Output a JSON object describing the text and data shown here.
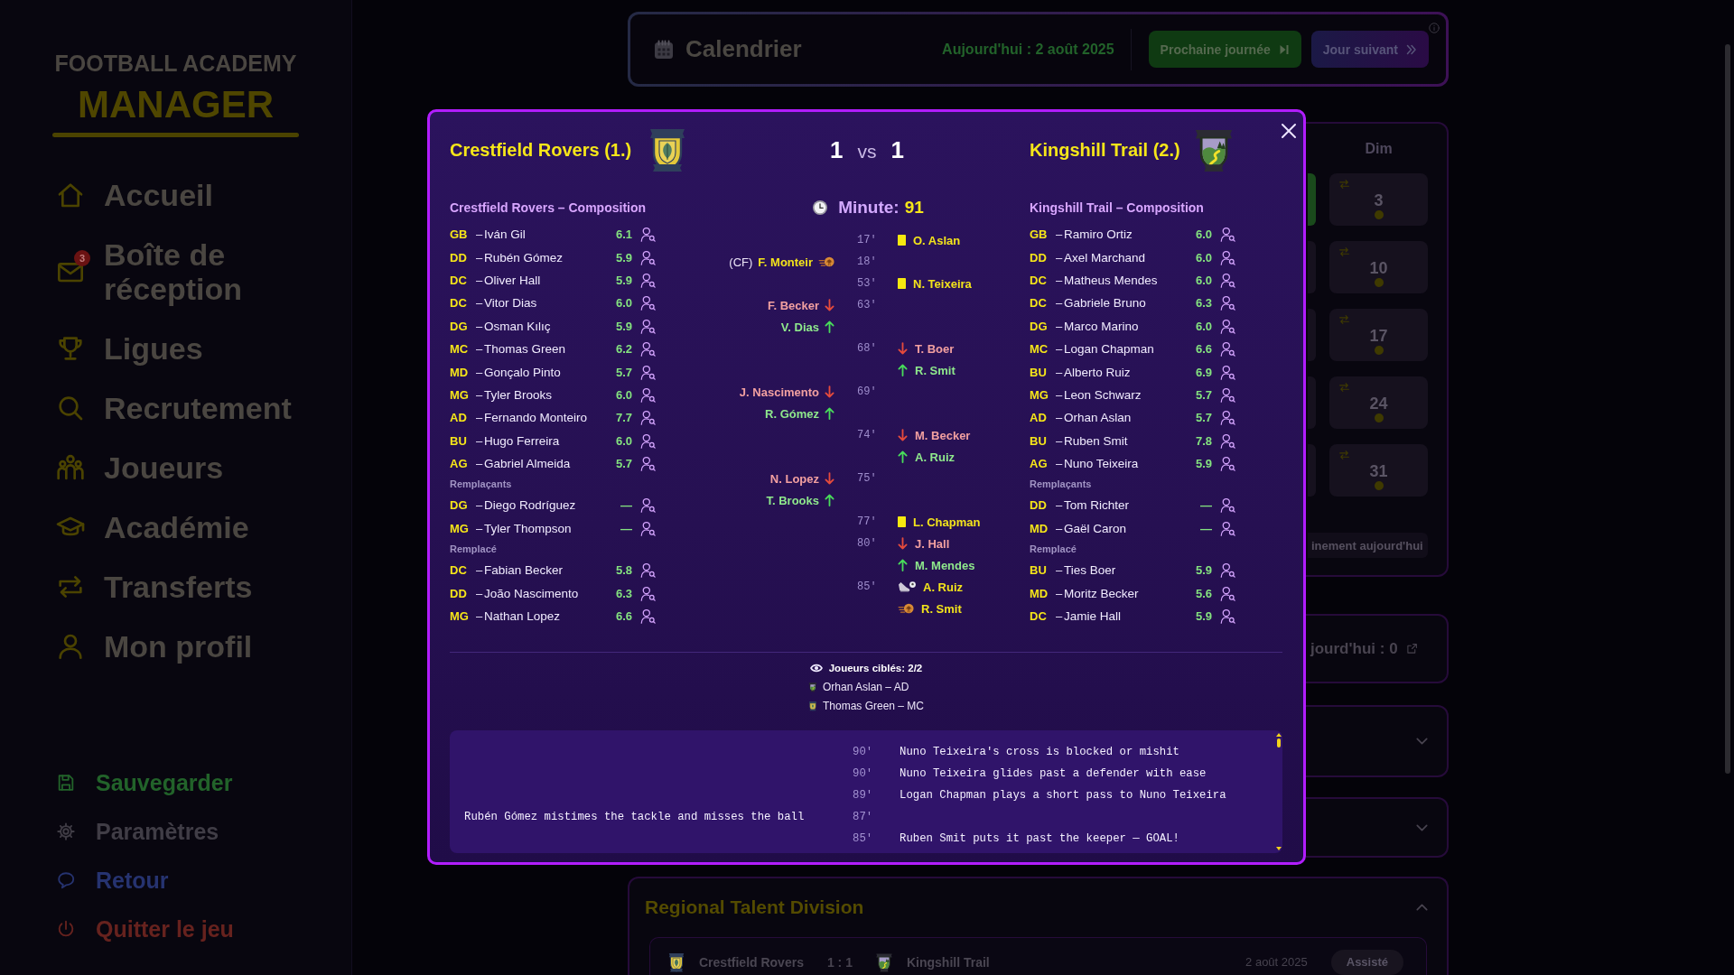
{
  "sidebar": {
    "logo": {
      "line_1": "FOOTBALL ACADEMY",
      "line_2": "MANAGER"
    },
    "nav_items": [
      {
        "label": "Accueil",
        "selected": false
      },
      {
        "label": "Boîte de réception",
        "selected": false,
        "badge": "3"
      },
      {
        "label": "Ligues",
        "selected": false
      },
      {
        "label": "Recrutement",
        "selected": false
      },
      {
        "label": "Joueurs",
        "selected": false
      },
      {
        "label": "Académie",
        "selected": false
      },
      {
        "label": "Transferts",
        "selected": false
      },
      {
        "label": "Mon profil",
        "selected": false
      }
    ],
    "footer_items": [
      {
        "label": "Sauvegarder",
        "kind": "save"
      },
      {
        "label": "Paramètres",
        "kind": "settings"
      },
      {
        "label": "Retour",
        "kind": "feedback"
      },
      {
        "label": "Quitter le jeu",
        "kind": "quit"
      }
    ]
  },
  "calendar_header": {
    "title": "Calendrier",
    "today": "Aujourd'hui : 2 août 2025",
    "buttons": [
      {
        "label": "Prochaine journée",
        "kind": "next_matchday"
      },
      {
        "label": "Jour suivant",
        "kind": "next_day"
      }
    ]
  },
  "calendar": {
    "weekday": "Dim",
    "cut_off_days": [
      {
        "today": true
      },
      {
        "today": false
      },
      {
        "today": false
      },
      {
        "today": false
      },
      {
        "today": false
      }
    ],
    "days": [
      {
        "date": "3"
      },
      {
        "date": "10"
      },
      {
        "date": "17"
      },
      {
        "date": "24"
      },
      {
        "date": "31"
      }
    ],
    "footer_button": "inement aujourd'hui"
  },
  "summary_card": {
    "text": "jourd'hui : 0"
  },
  "sections": [
    {
      "expanded": false
    },
    {
      "expanded": false
    },
    {
      "title": "Regional Talent Division",
      "expanded": true,
      "matches": [
        {
          "home": "Crestfield Rovers",
          "score": "1 : 1",
          "away": "Kingshill Trail",
          "date": "2 août 2025",
          "status": "Assisté"
        }
      ]
    }
  ],
  "match_dialog": {
    "home": {
      "name": "Crestfield Rovers (1.)",
      "score": "1",
      "lineup_title": "Crestfield Rovers – Composition",
      "starters": [
        {
          "position": "GB",
          "separator": "–",
          "name": "Iván Gil",
          "rating": "6.1"
        },
        {
          "position": "DD",
          "separator": "–",
          "name": "Rubén Gómez",
          "rating": "5.9"
        },
        {
          "position": "DC",
          "separator": "–",
          "name": "Oliver Hall",
          "rating": "5.9"
        },
        {
          "position": "DC",
          "separator": "–",
          "name": "Vitor Dias",
          "rating": "6.0"
        },
        {
          "position": "DG",
          "separator": "–",
          "name": "Osman Kılıç",
          "rating": "5.9"
        },
        {
          "position": "MC",
          "separator": "–",
          "name": "Thomas Green",
          "rating": "6.2"
        },
        {
          "position": "MD",
          "separator": "–",
          "name": "Gonçalo Pinto",
          "rating": "5.7"
        },
        {
          "position": "MG",
          "separator": "–",
          "name": "Tyler Brooks",
          "rating": "6.0"
        },
        {
          "position": "AD",
          "separator": "–",
          "name": "Fernando Monteiro",
          "rating": "7.7"
        },
        {
          "position": "BU",
          "separator": "–",
          "name": "Hugo Ferreira",
          "rating": "6.0"
        },
        {
          "position": "AG",
          "separator": "–",
          "name": "Gabriel Almeida",
          "rating": "5.7"
        }
      ],
      "substitutes_label": "Remplaçants",
      "substitutes": [
        {
          "position": "DG",
          "separator": "–",
          "name": "Diego Rodríguez",
          "rating": "—"
        },
        {
          "position": "MG",
          "separator": "–",
          "name": "Tyler Thompson",
          "rating": "—"
        }
      ],
      "replaced_label": "Remplacé",
      "replaced": [
        {
          "position": "DC",
          "separator": "–",
          "name": "Fabian Becker",
          "rating": "5.8"
        },
        {
          "position": "DD",
          "separator": "–",
          "name": "João Nascimento",
          "rating": "6.3"
        },
        {
          "position": "MG",
          "separator": "–",
          "name": "Nathan Lopez",
          "rating": "6.6"
        }
      ]
    },
    "versus": "vs",
    "away": {
      "name": "Kingshill Trail (2.)",
      "score": "1",
      "lineup_title": "Kingshill Trail – Composition",
      "starters": [
        {
          "position": "GB",
          "separator": "–",
          "name": "Ramiro Ortiz",
          "rating": "6.0"
        },
        {
          "position": "DD",
          "separator": "–",
          "name": "Axel Marchand",
          "rating": "6.0"
        },
        {
          "position": "DC",
          "separator": "–",
          "name": "Matheus Mendes",
          "rating": "6.0"
        },
        {
          "position": "DC",
          "separator": "–",
          "name": "Gabriele Bruno",
          "rating": "6.3"
        },
        {
          "position": "DG",
          "separator": "–",
          "name": "Marco Marino",
          "rating": "6.0"
        },
        {
          "position": "MC",
          "separator": "–",
          "name": "Logan Chapman",
          "rating": "6.6"
        },
        {
          "position": "BU",
          "separator": "–",
          "name": "Alberto Ruiz",
          "rating": "6.9"
        },
        {
          "position": "MG",
          "separator": "–",
          "name": "Leon Schwarz",
          "rating": "5.7"
        },
        {
          "position": "AD",
          "separator": "–",
          "name": "Orhan Aslan",
          "rating": "5.7"
        },
        {
          "position": "BU",
          "separator": "–",
          "name": "Ruben Smit",
          "rating": "7.8"
        },
        {
          "position": "AG",
          "separator": "–",
          "name": "Nuno Teixeira",
          "rating": "5.9"
        }
      ],
      "substitutes_label": "Remplaçants",
      "substitutes": [
        {
          "position": "DD",
          "separator": "–",
          "name": "Tom Richter",
          "rating": "—"
        },
        {
          "position": "MD",
          "separator": "–",
          "name": "Gaël Caron",
          "rating": "—"
        }
      ],
      "replaced_label": "Remplacé",
      "replaced": [
        {
          "position": "BU",
          "separator": "–",
          "name": "Ties Boer",
          "rating": "5.9"
        },
        {
          "position": "MD",
          "separator": "–",
          "name": "Moritz Becker",
          "rating": "5.6"
        },
        {
          "position": "DC",
          "separator": "–",
          "name": "Jamie Hall",
          "rating": "5.9"
        }
      ]
    },
    "minute_label": "Minute:",
    "minute": "91",
    "events": [
      {
        "minute": "17'",
        "away": {
          "kind": "yellow_card",
          "player": "O. Aslan"
        }
      },
      {
        "minute": "18'",
        "home": {
          "kind": "goal",
          "tag": "(CF)",
          "player": "F. Monteir"
        }
      },
      {
        "minute": "53'",
        "away": {
          "kind": "yellow_card",
          "player": "N. Teixeira"
        }
      },
      {
        "minute": "63'",
        "home": {
          "kind": "sub_out",
          "player": "F. Becker"
        }
      },
      {
        "home": {
          "kind": "sub_in",
          "player": "V. Dias"
        }
      },
      {
        "minute": "68'",
        "away": {
          "kind": "sub_out",
          "player": "T. Boer"
        }
      },
      {
        "away": {
          "kind": "sub_in",
          "player": "R. Smit"
        }
      },
      {
        "minute": "69'",
        "home": {
          "kind": "sub_out",
          "player": "J. Nascimento"
        }
      },
      {
        "home": {
          "kind": "sub_in",
          "player": "R. Gómez"
        }
      },
      {
        "minute": "74'",
        "away": {
          "kind": "sub_out",
          "player": "M. Becker"
        }
      },
      {
        "away": {
          "kind": "sub_in",
          "player": "A. Ruiz"
        }
      },
      {
        "minute": "75'",
        "home": {
          "kind": "sub_out",
          "player": "N. Lopez"
        }
      },
      {
        "home": {
          "kind": "sub_in",
          "player": "T. Brooks"
        }
      },
      {
        "minute": "77'",
        "away": {
          "kind": "yellow_card",
          "player": "L. Chapman"
        }
      },
      {
        "minute": "80'",
        "away": {
          "kind": "sub_out",
          "player": "J. Hall"
        }
      },
      {
        "away": {
          "kind": "sub_in",
          "player": "M. Mendes"
        }
      },
      {
        "minute": "85'",
        "away": {
          "kind": "assist",
          "player": "A. Ruiz"
        }
      },
      {
        "away": {
          "kind": "goal",
          "player": "R. Smit"
        }
      }
    ],
    "targeted": {
      "title": "Joueurs ciblés: 2/2",
      "players": [
        {
          "kind": "away_team",
          "text": "Orhan Aslan – AD"
        },
        {
          "kind": "home_team",
          "text": "Thomas Green – MC"
        }
      ]
    },
    "commentary": [
      {
        "minute": "90'",
        "away": "Nuno Teixeira's cross is blocked or mishit"
      },
      {
        "minute": "90'",
        "away": "Nuno Teixeira glides past a defender with ease"
      },
      {
        "minute": "89'",
        "away": "Logan Chapman plays a short pass to Nuno Teixeira"
      },
      {
        "minute": "87'",
        "home": "Rubén Gómez mistimes the tackle and misses the ball"
      },
      {
        "minute": "85'",
        "away": "Ruben Smit puts it past the keeper — GOAL!"
      }
    ]
  }
}
